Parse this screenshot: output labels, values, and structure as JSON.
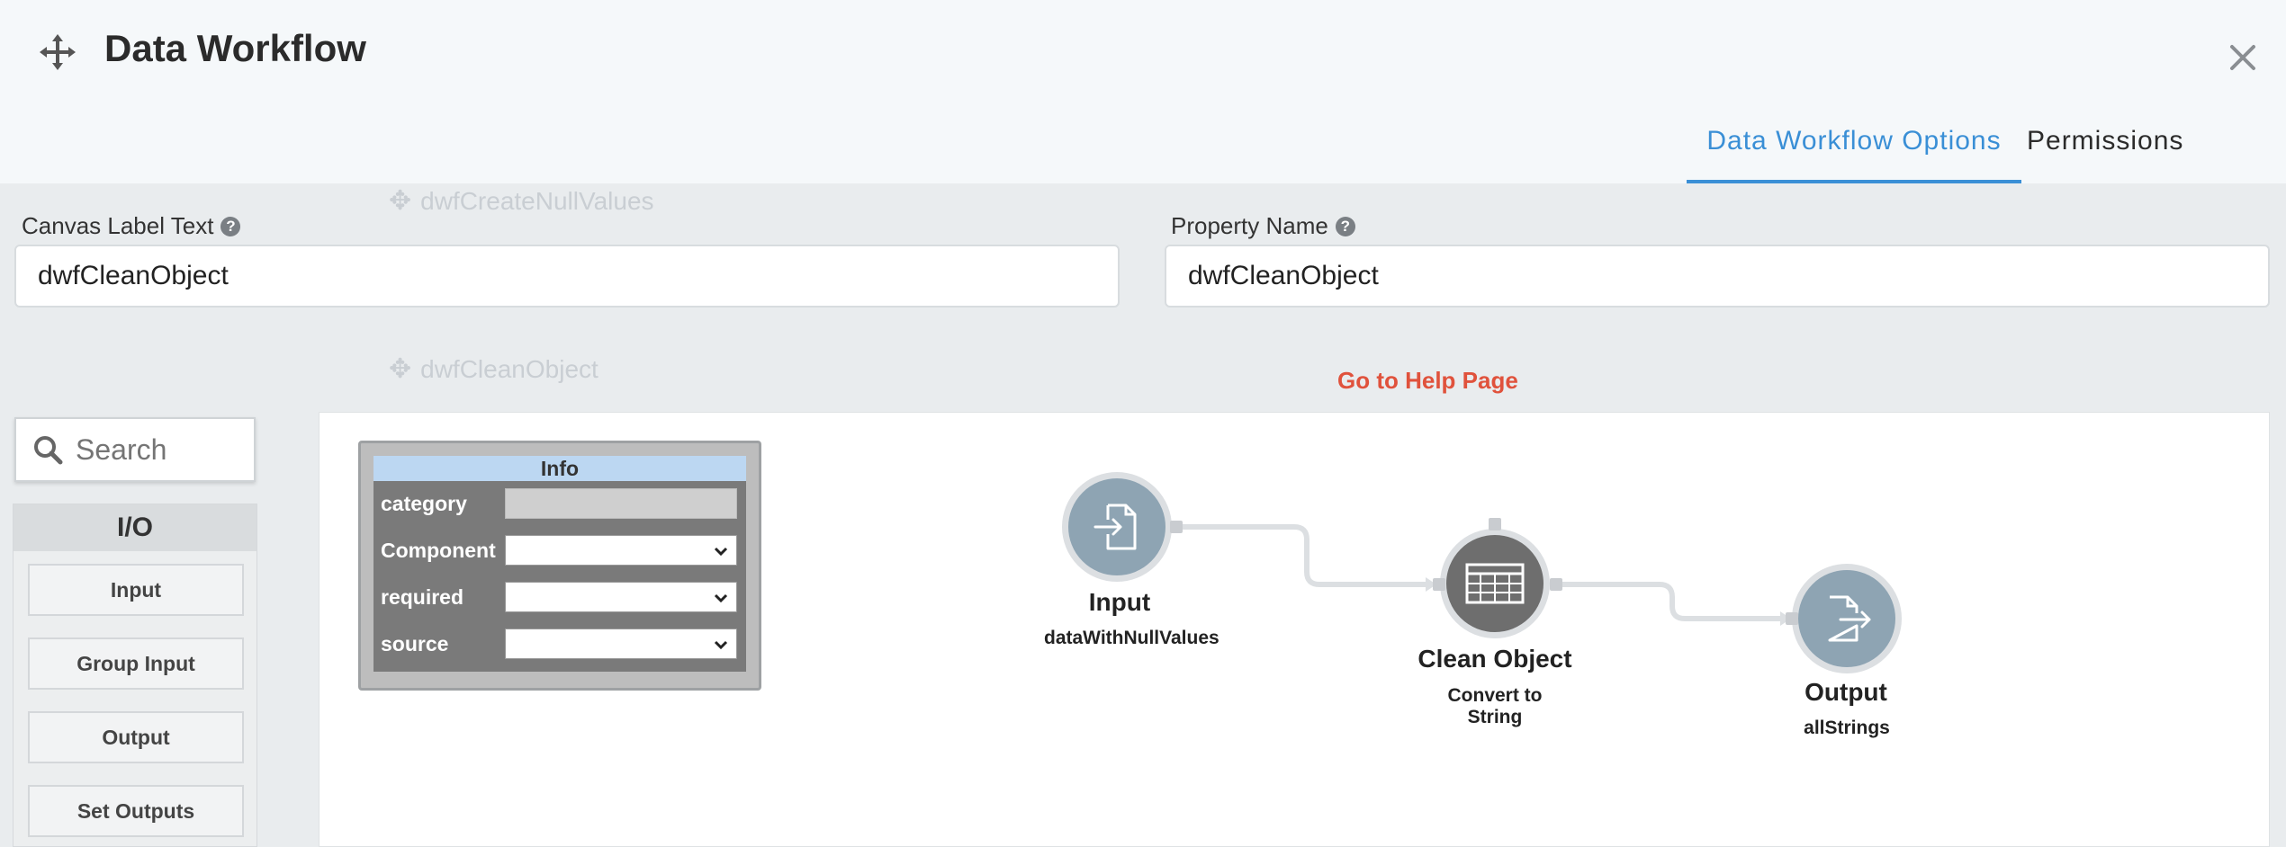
{
  "window": {
    "title": "Data Workflow"
  },
  "tabs": [
    {
      "label": "Data Workflow Options",
      "active": true
    },
    {
      "label": "Permissions",
      "active": false
    }
  ],
  "background_ghost": {
    "item_1": "dwfCreateNullValues",
    "item_2": "dwfCleanObject"
  },
  "fields": {
    "canvas_label": {
      "label": "Canvas Label Text",
      "value": "dwfCleanObject"
    },
    "property_name": {
      "label": "Property Name",
      "value": "dwfCleanObject"
    }
  },
  "help_link": "Go to Help Page",
  "palette": {
    "search_placeholder": "Search",
    "section": "I/O",
    "items": [
      "Input",
      "Group Input",
      "Output",
      "Set Outputs"
    ]
  },
  "info_panel": {
    "title": "Info",
    "rows": [
      {
        "label": "category",
        "value": ""
      },
      {
        "label": "Component",
        "value": ""
      },
      {
        "label": "required",
        "value": ""
      },
      {
        "label": "source",
        "value": ""
      }
    ]
  },
  "nodes": [
    {
      "name": "Input",
      "subtitle": "dataWithNullValues",
      "icon": "file-import-icon"
    },
    {
      "name": "Clean Object",
      "subtitle": "Convert to String",
      "icon": "table-icon"
    },
    {
      "name": "Output",
      "subtitle": "allStrings",
      "icon": "file-export-icon"
    }
  ],
  "colors": {
    "accent": "#3a8fd6",
    "help_link": "#e0523c",
    "node_light": "#8ea4b3",
    "node_dark": "#6e6e6e"
  }
}
